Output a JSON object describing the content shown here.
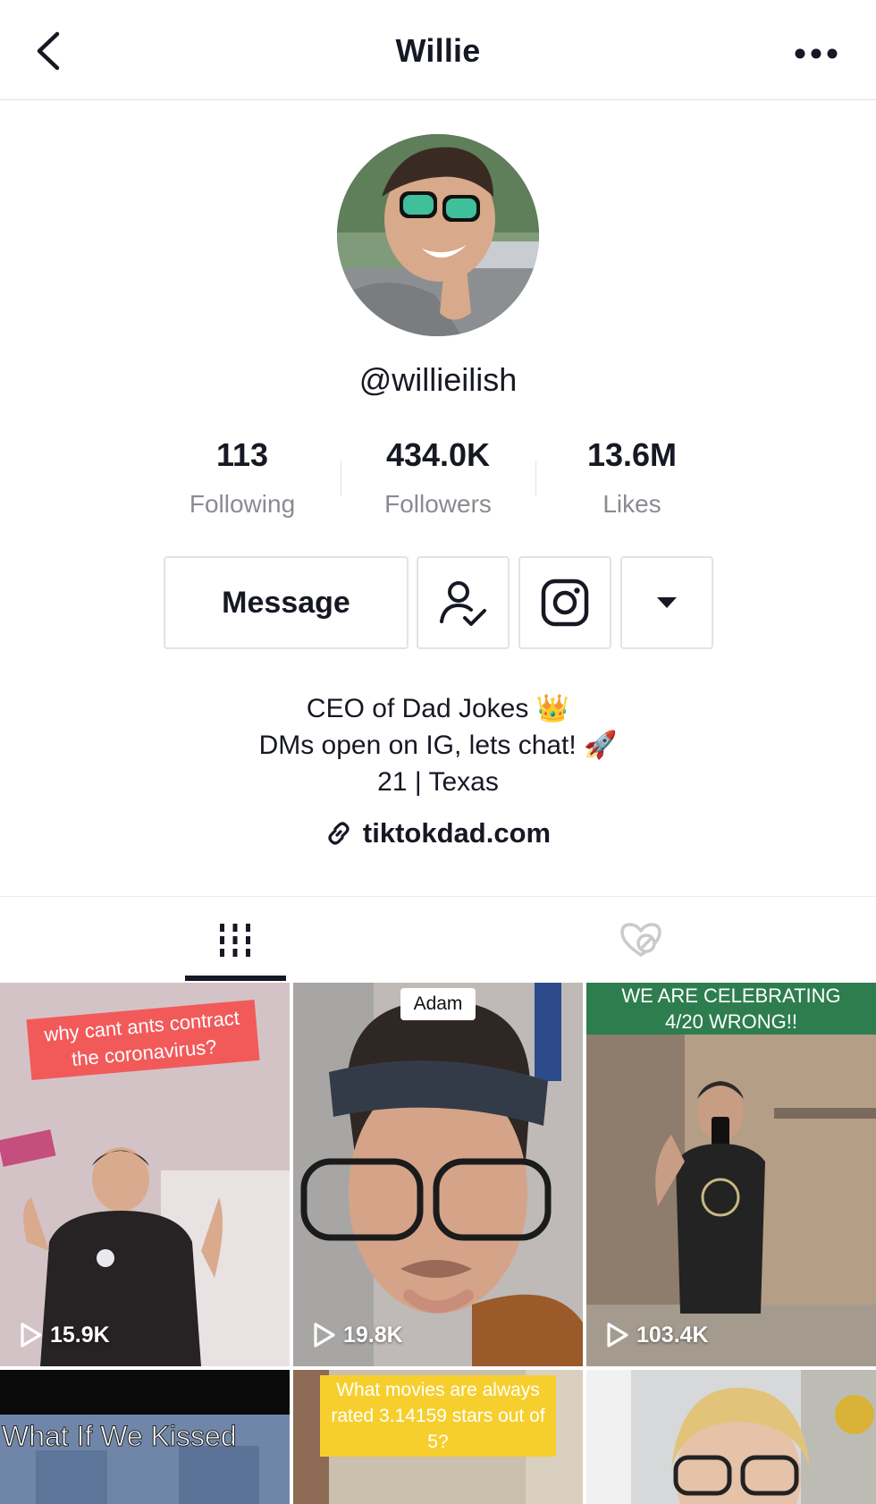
{
  "header": {
    "title": "Willie"
  },
  "profile": {
    "handle": "@willieilish",
    "stats": [
      {
        "value": "113",
        "label": "Following"
      },
      {
        "value": "434.0K",
        "label": "Followers"
      },
      {
        "value": "13.6M",
        "label": "Likes"
      }
    ],
    "message_label": "Message",
    "bio": [
      "CEO of Dad Jokes 👑",
      "DMs open on IG, lets chat! 🚀",
      "21 | Texas"
    ],
    "link": "tiktokdad.com"
  },
  "tabs": [
    "videos-grid-icon",
    "liked-hidden-icon"
  ],
  "videos": [
    {
      "caption": "why cant ants contract the coronavirus?",
      "views": "15.9K"
    },
    {
      "caption": "Adam",
      "views": "19.8K"
    },
    {
      "caption": "WE ARE CELEBRATING 4/20 WRONG!!",
      "views": "103.4K"
    },
    {
      "caption": "What If We Kissed",
      "views": ""
    },
    {
      "caption": "What movies are always rated 3.14159 stars out of 5?",
      "views": ""
    },
    {
      "caption": "",
      "views": ""
    }
  ],
  "colors": {
    "text": "#161823",
    "muted": "#8a8b91",
    "border": "#e3e3e4",
    "caption_red": "#f25a5a",
    "caption_yellow": "#f6cf2e",
    "caption_green": "#2e7d4f"
  }
}
